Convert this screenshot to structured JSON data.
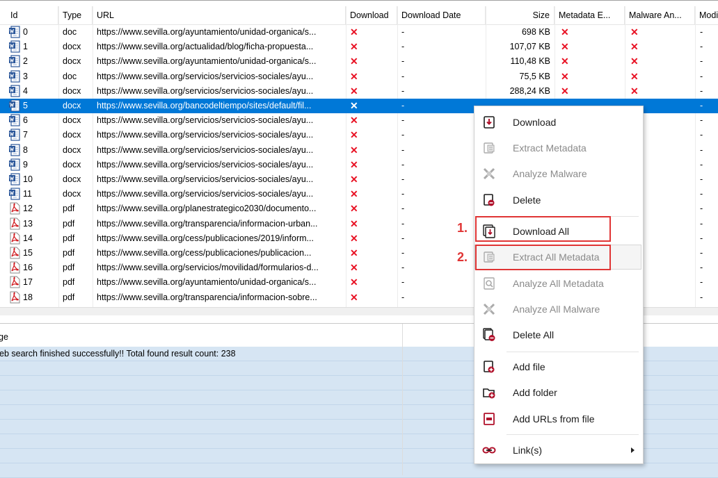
{
  "columns": {
    "id": "Id",
    "type": "Type",
    "url": "URL",
    "download": "Download",
    "download_date": "Download Date",
    "size": "Size",
    "metadata": "Metadata E...",
    "malware": "Malware An...",
    "modified": "Modi"
  },
  "rows": [
    {
      "id": "0",
      "type": "doc",
      "url": "https://www.sevilla.org/ayuntamiento/unidad-organica/s...",
      "download": "✕",
      "date": "-",
      "size": "698 KB",
      "meta": "✕",
      "mal": "✕",
      "mod": "-"
    },
    {
      "id": "1",
      "type": "docx",
      "url": "https://www.sevilla.org/actualidad/blog/ficha-propuesta...",
      "download": "✕",
      "date": "-",
      "size": "107,07 KB",
      "meta": "✕",
      "mal": "✕",
      "mod": "-"
    },
    {
      "id": "2",
      "type": "docx",
      "url": "https://www.sevilla.org/ayuntamiento/unidad-organica/s...",
      "download": "✕",
      "date": "-",
      "size": "110,48 KB",
      "meta": "✕",
      "mal": "✕",
      "mod": "-"
    },
    {
      "id": "3",
      "type": "doc",
      "url": "https://www.sevilla.org/servicios/servicios-sociales/ayu...",
      "download": "✕",
      "date": "-",
      "size": "75,5 KB",
      "meta": "✕",
      "mal": "✕",
      "mod": "-"
    },
    {
      "id": "4",
      "type": "docx",
      "url": "https://www.sevilla.org/servicios/servicios-sociales/ayu...",
      "download": "✕",
      "date": "-",
      "size": "288,24 KB",
      "meta": "✕",
      "mal": "✕",
      "mod": "-"
    },
    {
      "id": "5",
      "type": "docx",
      "url": "https://www.sevilla.org/bancodeltiempo/sites/default/fil...",
      "download": "✕",
      "date": "-",
      "size": "",
      "meta": "",
      "mal": "",
      "mod": "-"
    },
    {
      "id": "6",
      "type": "docx",
      "url": "https://www.sevilla.org/servicios/servicios-sociales/ayu...",
      "download": "✕",
      "date": "-",
      "size": "",
      "meta": "",
      "mal": "",
      "mod": "-"
    },
    {
      "id": "7",
      "type": "docx",
      "url": "https://www.sevilla.org/servicios/servicios-sociales/ayu...",
      "download": "✕",
      "date": "-",
      "size": "",
      "meta": "",
      "mal": "",
      "mod": "-"
    },
    {
      "id": "8",
      "type": "docx",
      "url": "https://www.sevilla.org/servicios/servicios-sociales/ayu...",
      "download": "✕",
      "date": "-",
      "size": "",
      "meta": "",
      "mal": "",
      "mod": "-"
    },
    {
      "id": "9",
      "type": "docx",
      "url": "https://www.sevilla.org/servicios/servicios-sociales/ayu...",
      "download": "✕",
      "date": "-",
      "size": "",
      "meta": "",
      "mal": "",
      "mod": "-"
    },
    {
      "id": "10",
      "type": "docx",
      "url": "https://www.sevilla.org/servicios/servicios-sociales/ayu...",
      "download": "✕",
      "date": "-",
      "size": "",
      "meta": "",
      "mal": "",
      "mod": "-"
    },
    {
      "id": "11",
      "type": "docx",
      "url": "https://www.sevilla.org/servicios/servicios-sociales/ayu...",
      "download": "✕",
      "date": "-",
      "size": "",
      "meta": "",
      "mal": "",
      "mod": "-"
    },
    {
      "id": "12",
      "type": "pdf",
      "url": "https://www.sevilla.org/planestrategico2030/documento...",
      "download": "✕",
      "date": "-",
      "size": "",
      "meta": "",
      "mal": "",
      "mod": "-"
    },
    {
      "id": "13",
      "type": "pdf",
      "url": "https://www.sevilla.org/transparencia/informacion-urban...",
      "download": "✕",
      "date": "-",
      "size": "",
      "meta": "",
      "mal": "",
      "mod": "-"
    },
    {
      "id": "14",
      "type": "pdf",
      "url": "https://www.sevilla.org/cess/publicaciones/2019/inform...",
      "download": "✕",
      "date": "-",
      "size": "",
      "meta": "",
      "mal": "",
      "mod": "-"
    },
    {
      "id": "15",
      "type": "pdf",
      "url": "https://www.sevilla.org/cess/publicaciones/publicacion...",
      "download": "✕",
      "date": "-",
      "size": "",
      "meta": "",
      "mal": "",
      "mod": "-"
    },
    {
      "id": "16",
      "type": "pdf",
      "url": "https://www.sevilla.org/servicios/movilidad/formularios-d...",
      "download": "✕",
      "date": "-",
      "size": "",
      "meta": "",
      "mal": "",
      "mod": "-"
    },
    {
      "id": "17",
      "type": "pdf",
      "url": "https://www.sevilla.org/ayuntamiento/unidad-organica/s...",
      "download": "✕",
      "date": "-",
      "size": "",
      "meta": "",
      "mal": "",
      "mod": "-"
    },
    {
      "id": "18",
      "type": "pdf",
      "url": "https://www.sevilla.org/transparencia/informacion-sobre...",
      "download": "✕",
      "date": "-",
      "size": "",
      "meta": "",
      "mal": "",
      "mod": "-"
    }
  ],
  "log": {
    "header": "ge",
    "message": "eb search finished successfully!! Total found result count: 238"
  },
  "menu": {
    "download": "Download",
    "extract_metadata": "Extract Metadata",
    "analyze_malware": "Analyze Malware",
    "delete": "Delete",
    "download_all": "Download All",
    "extract_all_metadata": "Extract All Metadata",
    "analyze_all_metadata": "Analyze All Metadata",
    "analyze_all_malware": "Analyze All Malware",
    "delete_all": "Delete All",
    "add_file": "Add file",
    "add_folder": "Add folder",
    "add_urls": "Add URLs from file",
    "links": "Link(s)"
  },
  "annotations": {
    "one": "1.",
    "two": "2."
  },
  "colors": {
    "selection": "#0078d7",
    "error_mark": "#e81123",
    "highlight": "#e03434",
    "accent_icon": "#b0102a"
  }
}
